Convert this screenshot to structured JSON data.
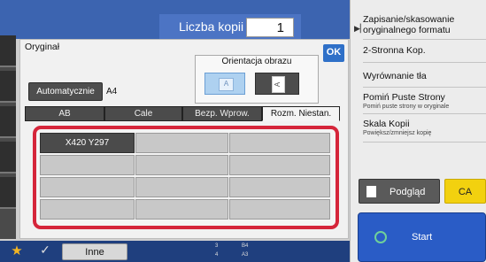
{
  "copies": {
    "label": "Liczba kopii",
    "value": "1"
  },
  "dialog": {
    "title": "Oryginał",
    "ok_label": "OK",
    "orientation": {
      "title": "Orientacja obrazu",
      "option_a_glyph": "A",
      "option_b_glyph": "A",
      "selected": "option_a"
    },
    "auto_button": "Automatycznie",
    "detected_size": "A4",
    "tabs": [
      {
        "label": "AB",
        "active": false
      },
      {
        "label": "Cale",
        "active": false
      },
      {
        "label": "Bezp. Wprow.",
        "active": false
      },
      {
        "label": "Rozm. Niestan.",
        "active": true
      }
    ],
    "custom_sizes": {
      "rows": [
        [
          "X420 Y297",
          "",
          ""
        ],
        [
          "",
          "",
          ""
        ],
        [
          "",
          "",
          ""
        ],
        [
          "",
          "",
          ""
        ]
      ]
    }
  },
  "right_panel": {
    "items": [
      {
        "label": "Zapisanie/skasowanie oryginalnego formatu",
        "sub": ""
      },
      {
        "label": "2-Stronna Kop.",
        "sub": ""
      },
      {
        "label": "Wyrównanie tła",
        "sub": ""
      },
      {
        "label": "Pomiń Puste Strony",
        "sub": "Pomiń puste strony w oryginale"
      },
      {
        "label": "Skala Kopii",
        "sub": "Powiększ/zmniejsz kopię"
      }
    ],
    "preview_label": "Podgląd",
    "ca_label": "CA",
    "start_label": "Start"
  },
  "bottom_bar": {
    "favorite_icon": "★",
    "check_icon": "✓",
    "other_label": "Inne",
    "trays": [
      {
        "number": "3",
        "size": "B4"
      },
      {
        "number": "4",
        "size": "A3"
      }
    ]
  },
  "colors": {
    "highlight": "#d5253a",
    "accent": "#2f70c8",
    "ca": "#f2d10f",
    "start": "#2a5cc6"
  }
}
